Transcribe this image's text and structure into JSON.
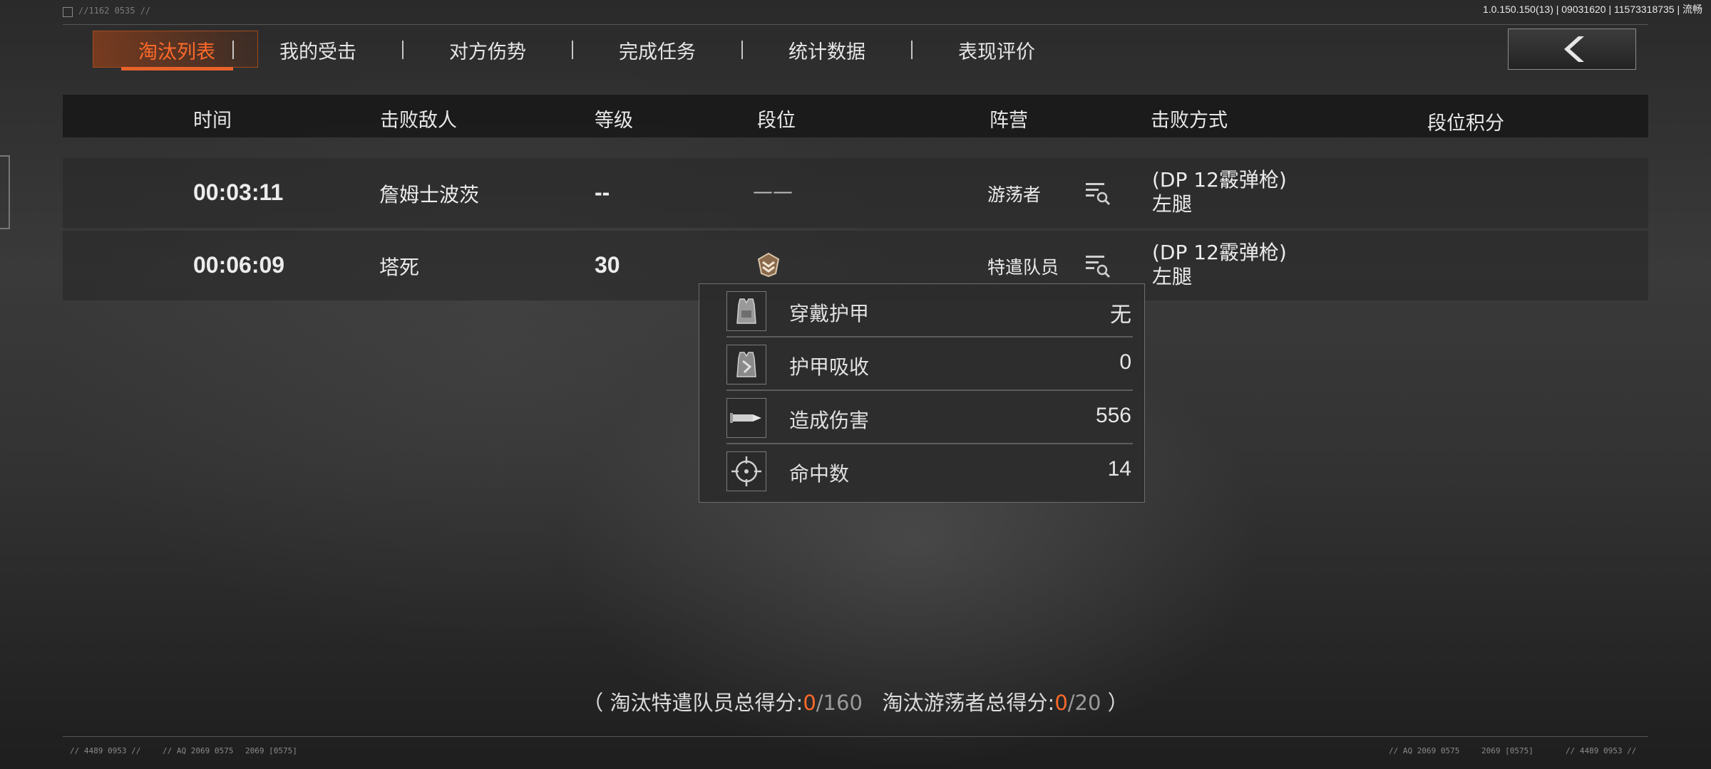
{
  "version": "1.0.150.150(13) | 09031620 | 11573318735 | 流畅",
  "top_code": "//1162  0535 //",
  "tabs": [
    {
      "label": "淘汰列表",
      "active": true
    },
    {
      "label": "我的受击"
    },
    {
      "label": "对方伤势"
    },
    {
      "label": "完成任务"
    },
    {
      "label": "统计数据"
    },
    {
      "label": "表现评价"
    }
  ],
  "back_icon": "chevron-left-icon",
  "columns": [
    "时间",
    "击败敌人",
    "等级",
    "段位",
    "阵营",
    "击败方式",
    "段位积分"
  ],
  "rows": [
    {
      "time": "00:03:11",
      "enemy": "詹姆士波茨",
      "level": "--",
      "rank": "——",
      "faction": "游荡者",
      "weapon": "(DP 12霰弹枪)",
      "body": "左腿"
    },
    {
      "time": "00:06:09",
      "enemy": "塔死",
      "level": "30",
      "rank_icon": "rank-badge-icon",
      "faction": "特遣队员",
      "weapon": "(DP 12霰弹枪)",
      "body": "左腿"
    }
  ],
  "popup": [
    {
      "icon": "vest-icon",
      "label": "穿戴护甲",
      "value": "无"
    },
    {
      "icon": "armor-absorb-icon",
      "label": "护甲吸收",
      "value": "0"
    },
    {
      "icon": "bullet-icon",
      "label": "造成伤害",
      "value": "556"
    },
    {
      "icon": "crosshair-icon",
      "label": "命中数",
      "value": "14"
    }
  ],
  "summary": {
    "open": "（",
    "agents_label": "淘汰特遣队员总得分:",
    "agents_score": "0",
    "agents_total": "/160",
    "wanderers_label": "淘汰游荡者总得分:",
    "wanderers_score": "0",
    "wanderers_total": "/20",
    "close": "）"
  },
  "footer": {
    "left_code": "// 4489 0953 //",
    "left_code2": "// AQ 2069 0575",
    "left_code3": "2069 [0575]",
    "right_code": "// AQ 2069 0575",
    "right_code2": "2069 [0575]",
    "right_code3": "// 4489 0953 //"
  }
}
